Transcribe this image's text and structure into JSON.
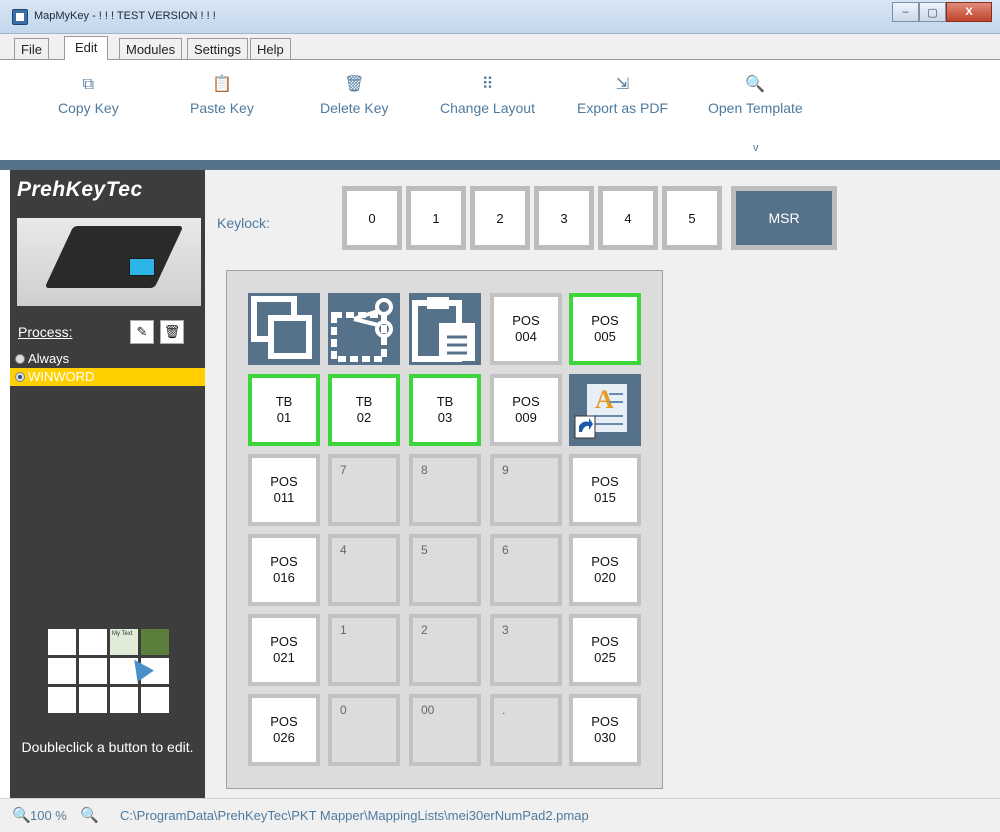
{
  "window": {
    "title": "MapMyKey - ! ! ! TEST VERSION ! ! !",
    "minimize": "–",
    "maximize": "▢",
    "close": "X"
  },
  "menu": [
    "File",
    "Edit",
    "Modules",
    "Settings",
    "Help"
  ],
  "toolbar": {
    "copy": {
      "label": "Copy Key",
      "icon": "⧉"
    },
    "paste": {
      "label": "Paste Key",
      "icon": "📋"
    },
    "delete": {
      "label": "Delete Key",
      "icon": "🗑"
    },
    "layout": {
      "label": "Change Layout",
      "icon": "⠿"
    },
    "export": {
      "label": "Export as PDF",
      "icon": "⇲"
    },
    "template": {
      "label": "Open Template",
      "icon": "🔍"
    },
    "expand": "v"
  },
  "sidebar": {
    "logo": "PrehKeyTec",
    "process_label": "Process:",
    "edit_icon": "✎",
    "trash_icon": "🗑",
    "processes": [
      {
        "label": "Always",
        "selected": false
      },
      {
        "label": "WINWORD",
        "selected": true
      }
    ],
    "mini_label": "My Text",
    "hint": "Doubleclick a button to edit."
  },
  "keylock": {
    "label": "Keylock:",
    "positions": [
      "0",
      "1",
      "2",
      "3",
      "4",
      "5"
    ],
    "msr": "MSR"
  },
  "keypad": {
    "rows": [
      [
        {
          "type": "img",
          "icon": "copy-icon"
        },
        {
          "type": "img",
          "icon": "cut-icon"
        },
        {
          "type": "img",
          "icon": "paste-icon"
        },
        {
          "type": "key",
          "l1": "POS",
          "l2": "004"
        },
        {
          "type": "green",
          "l1": "POS",
          "l2": "005"
        }
      ],
      [
        {
          "type": "green",
          "l1": "TB",
          "l2": "01"
        },
        {
          "type": "green",
          "l1": "TB",
          "l2": "02"
        },
        {
          "type": "green",
          "l1": "TB",
          "l2": "03"
        },
        {
          "type": "key",
          "l1": "POS",
          "l2": "009"
        },
        {
          "type": "img",
          "icon": "word-shortcut-icon"
        }
      ],
      [
        {
          "type": "key",
          "l1": "POS",
          "l2": "011"
        },
        {
          "type": "empty",
          "l1": "7"
        },
        {
          "type": "empty",
          "l1": "8"
        },
        {
          "type": "empty",
          "l1": "9"
        },
        {
          "type": "key",
          "l1": "POS",
          "l2": "015"
        }
      ],
      [
        {
          "type": "key",
          "l1": "POS",
          "l2": "016"
        },
        {
          "type": "empty",
          "l1": "4"
        },
        {
          "type": "empty",
          "l1": "5"
        },
        {
          "type": "empty",
          "l1": "6"
        },
        {
          "type": "key",
          "l1": "POS",
          "l2": "020"
        }
      ],
      [
        {
          "type": "key",
          "l1": "POS",
          "l2": "021"
        },
        {
          "type": "empty",
          "l1": "1"
        },
        {
          "type": "empty",
          "l1": "2"
        },
        {
          "type": "empty",
          "l1": "3"
        },
        {
          "type": "key",
          "l1": "POS",
          "l2": "025"
        }
      ],
      [
        {
          "type": "key",
          "l1": "POS",
          "l2": "026"
        },
        {
          "type": "empty",
          "l1": "0"
        },
        {
          "type": "empty",
          "l1": "00"
        },
        {
          "type": "empty",
          "l1": "."
        },
        {
          "type": "key",
          "l1": "POS",
          "l2": "030"
        }
      ]
    ]
  },
  "status": {
    "zoom": "100 %",
    "path": "C:\\ProgramData\\PrehKeyTec\\PKT Mapper\\MappingLists\\mei30erNumPad2.pmap"
  },
  "colors": {
    "accent": "#56728a",
    "text_accent": "#4e7a9e",
    "highlight": "#ffcf00",
    "green": "#3cd63c"
  }
}
